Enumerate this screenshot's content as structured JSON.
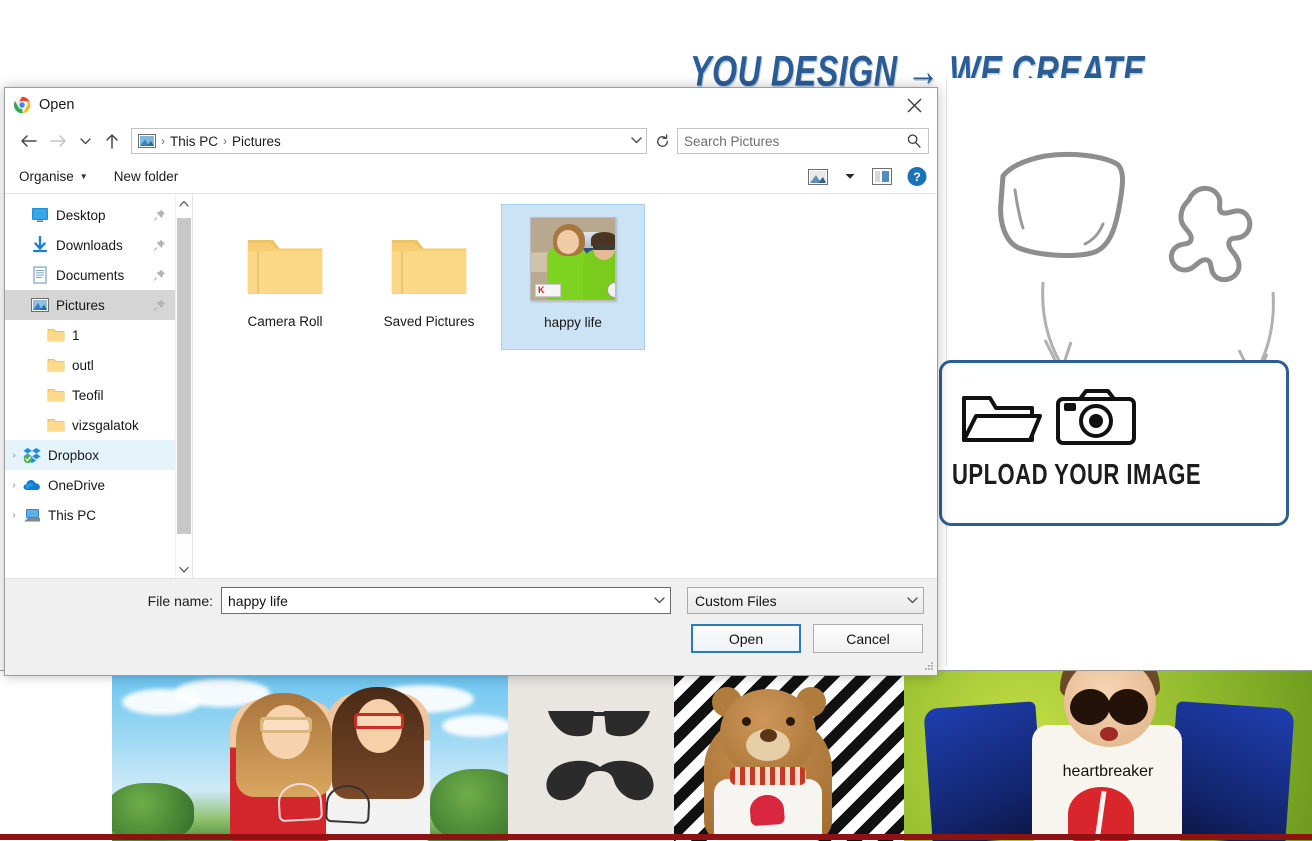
{
  "background": {
    "headline": "YOU DESIGN → WE CREATE.",
    "upload_caption": "UPLOAD YOUR IMAGE",
    "sketch_pillow_name": "pillow-sketch",
    "sketch_puzzle_name": "puzzle-piece-sketch",
    "photos": [
      {
        "name": "friends-forever-tshirts-photo",
        "caption": ""
      },
      {
        "name": "mustache-pillow-teddy-photo",
        "caption": ""
      },
      {
        "name": "heartbreaker-boy-photo",
        "caption": "heartbreaker"
      }
    ]
  },
  "dialog": {
    "title": "Open",
    "close_label": "✕",
    "nav": {
      "back": "←",
      "forward": "→",
      "recent": "⌄",
      "up": "↑",
      "refresh": "↻",
      "address_caret": "⌄",
      "breadcrumbs": [
        "This PC",
        "Pictures"
      ],
      "separator": "›"
    },
    "search": {
      "placeholder": "Search Pictures",
      "value": ""
    },
    "command_bar": {
      "organise": "Organise",
      "organise_caret": "▼",
      "new_folder": "New folder",
      "view_caret": "▼",
      "help_glyph": "?"
    },
    "tree": [
      {
        "label": "Desktop",
        "icon": "desktop-icon",
        "indent": 1,
        "pinned": true,
        "state": "normal",
        "expander": ""
      },
      {
        "label": "Downloads",
        "icon": "downloads-icon",
        "indent": 1,
        "pinned": true,
        "state": "normal",
        "expander": ""
      },
      {
        "label": "Documents",
        "icon": "documents-icon",
        "indent": 1,
        "pinned": true,
        "state": "normal",
        "expander": ""
      },
      {
        "label": "Pictures",
        "icon": "pictures-icon",
        "indent": 1,
        "pinned": true,
        "state": "selected",
        "expander": ""
      },
      {
        "label": "1",
        "icon": "folder-icon",
        "indent": 2,
        "pinned": false,
        "state": "normal",
        "expander": ""
      },
      {
        "label": "outl",
        "icon": "folder-icon",
        "indent": 2,
        "pinned": false,
        "state": "normal",
        "expander": ""
      },
      {
        "label": "Teofil",
        "icon": "folder-icon",
        "indent": 2,
        "pinned": false,
        "state": "normal",
        "expander": ""
      },
      {
        "label": "vizsgalatok",
        "icon": "folder-icon",
        "indent": 2,
        "pinned": false,
        "state": "normal",
        "expander": ""
      },
      {
        "label": "Dropbox",
        "icon": "dropbox-icon",
        "indent": 0,
        "pinned": false,
        "state": "hover",
        "expander": "›"
      },
      {
        "label": "OneDrive",
        "icon": "onedrive-icon",
        "indent": 0,
        "pinned": false,
        "state": "normal",
        "expander": "›"
      },
      {
        "label": "This PC",
        "icon": "thispc-icon",
        "indent": 0,
        "pinned": false,
        "state": "normal",
        "expander": "›"
      }
    ],
    "scrollbar": {
      "up": "⌃",
      "down": "⌄"
    },
    "files": [
      {
        "label": "Camera Roll",
        "kind": "folder",
        "selected": false
      },
      {
        "label": "Saved Pictures",
        "kind": "folder",
        "selected": false
      },
      {
        "label": "happy life",
        "kind": "picture",
        "selected": true
      }
    ],
    "footer": {
      "filename_label": "File name:",
      "filename_value": "happy life",
      "filename_caret": "⌄",
      "filetype_value": "Custom Files",
      "filetype_caret": "⌄",
      "open_button": "Open",
      "cancel_button": "Cancel"
    }
  }
}
